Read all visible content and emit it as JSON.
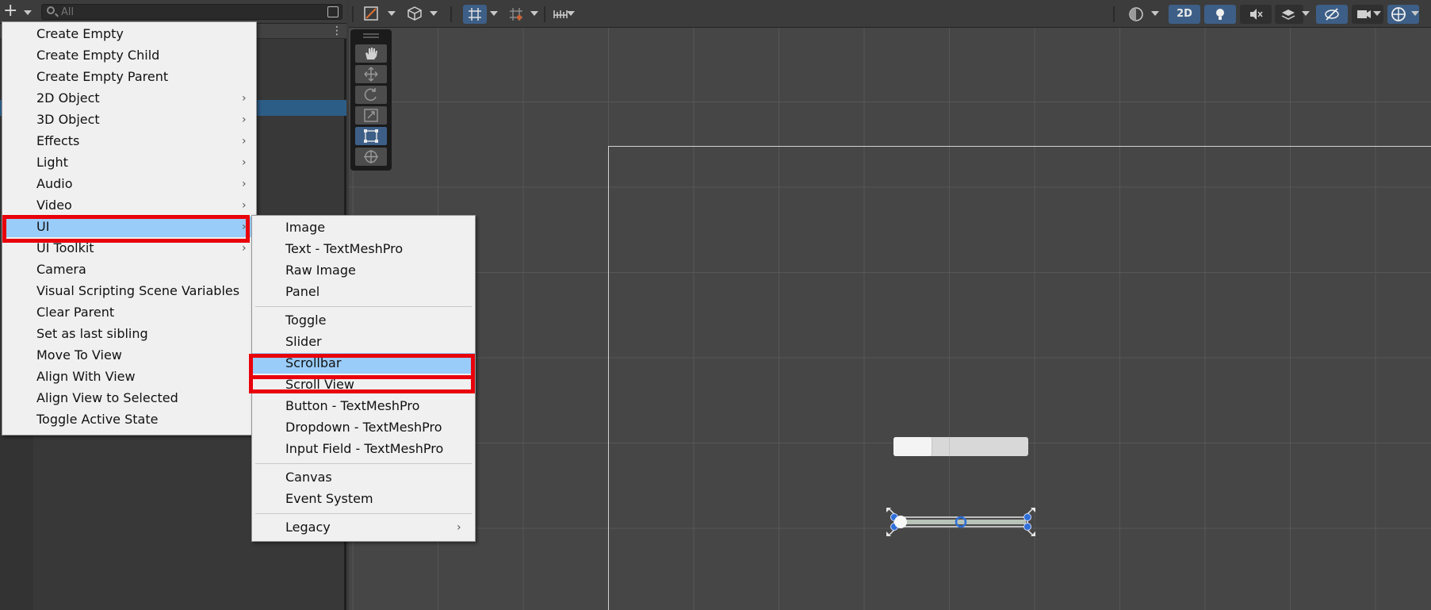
{
  "hierarchy": {
    "search": {
      "placeholder": "All"
    },
    "kebab": "⋮",
    "add_symbol": "+"
  },
  "scene": {
    "toolbar": {
      "mode_2d_label": "2D"
    }
  },
  "main_menu": {
    "items": [
      {
        "label": "Create Empty",
        "submenu": false
      },
      {
        "label": "Create Empty Child",
        "submenu": false
      },
      {
        "label": "Create Empty Parent",
        "submenu": false
      },
      {
        "label": "2D Object",
        "submenu": true
      },
      {
        "label": "3D Object",
        "submenu": true
      },
      {
        "label": "Effects",
        "submenu": true
      },
      {
        "label": "Light",
        "submenu": true
      },
      {
        "label": "Audio",
        "submenu": true
      },
      {
        "label": "Video",
        "submenu": true
      },
      {
        "label": "UI",
        "submenu": true,
        "highlighted": true
      },
      {
        "label": "UI Toolkit",
        "submenu": true
      },
      {
        "label": "Camera",
        "submenu": false
      },
      {
        "label": "Visual Scripting Scene Variables",
        "submenu": false
      },
      {
        "label": "Clear Parent",
        "submenu": false
      },
      {
        "label": "Set as last sibling",
        "submenu": false
      },
      {
        "label": "Move To View",
        "submenu": false
      },
      {
        "label": "Align With View",
        "submenu": false
      },
      {
        "label": "Align View to Selected",
        "submenu": false
      },
      {
        "label": "Toggle Active State",
        "submenu": false
      }
    ]
  },
  "ui_submenu": {
    "groups": [
      [
        "Image",
        "Text - TextMeshPro",
        "Raw Image",
        "Panel"
      ],
      [
        "Toggle",
        "Slider",
        "Scrollbar",
        "Scroll View",
        "Button - TextMeshPro",
        "Dropdown - TextMeshPro",
        "Input Field - TextMeshPro"
      ],
      [
        "Canvas",
        "Event System"
      ],
      [
        "Legacy"
      ]
    ],
    "highlighted": "Scrollbar",
    "submenu_items": [
      "Legacy"
    ]
  },
  "colors": {
    "menu_highlight": "#99ccf9",
    "annotation_box": "#e8000b",
    "active_tool": "#3d5f87"
  },
  "icons": [
    "search-icon",
    "hand-tool-icon",
    "move-tool-icon",
    "rotate-tool-icon",
    "scale-tool-icon",
    "rect-tool-icon",
    "transform-tool-icon",
    "lighting-icon",
    "gizmo-icon"
  ]
}
